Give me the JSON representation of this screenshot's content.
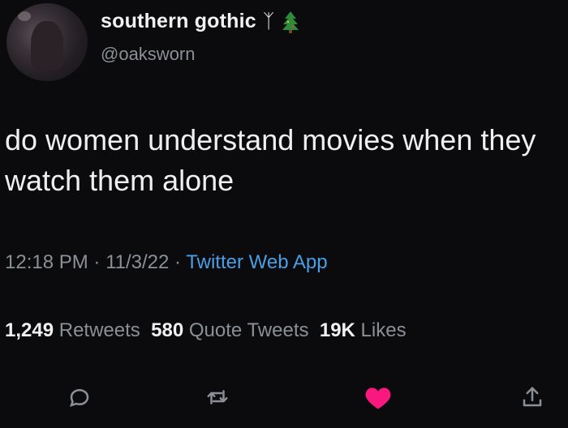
{
  "author": {
    "display_name": "southern gothic",
    "emoji_1": "ᛉ",
    "emoji_2": "tree-icon",
    "handle": "@oaksworn"
  },
  "tweet": {
    "text": "do women understand movies when they watch them alone",
    "time": "12:18 PM",
    "date": "11/3/22",
    "separator": "·",
    "source": "Twitter Web App"
  },
  "stats": {
    "retweets_count": "1,249",
    "retweets_label": "Retweets",
    "quotes_count": "580",
    "quotes_label": "Quote Tweets",
    "likes_count": "19K",
    "likes_label": "Likes"
  },
  "actions": {
    "reply": "reply-icon",
    "retweet": "retweet-icon",
    "like": "heart-icon",
    "share": "share-icon"
  },
  "colors": {
    "background": "#0b0b0d",
    "text": "#efeff1",
    "muted": "#8b8f96",
    "link": "#4a9ee6",
    "like_active": "#f91880",
    "tree": "#2e8b3a"
  }
}
